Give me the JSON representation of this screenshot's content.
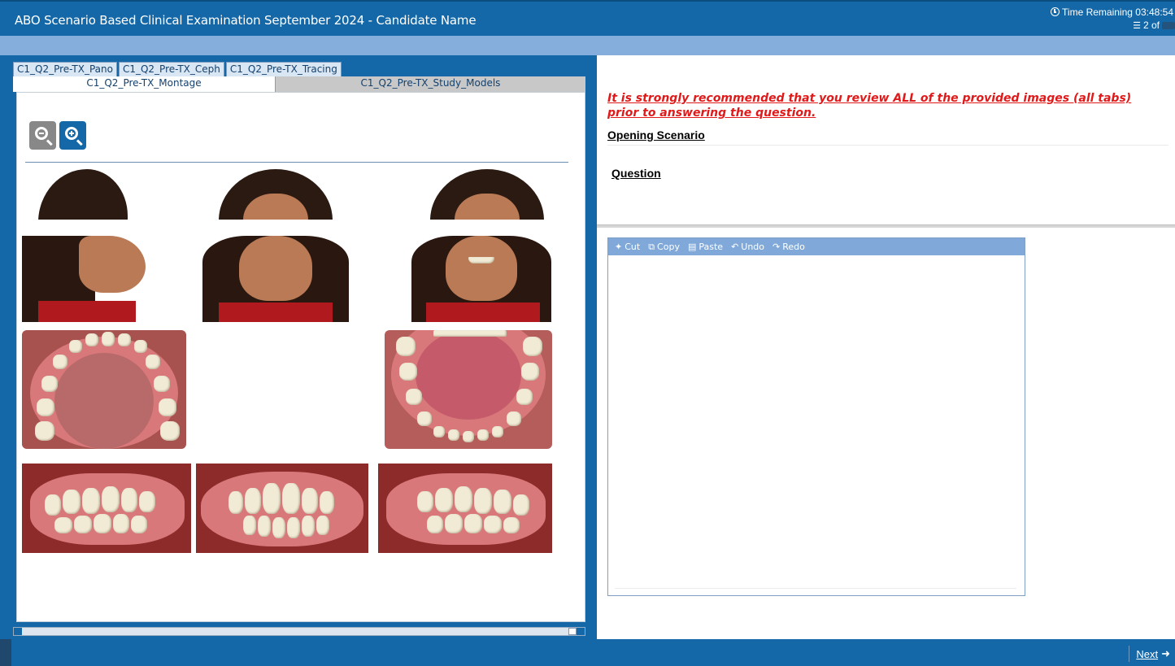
{
  "header": {
    "title": "ABO Scenario Based Clinical Examination September 2024 - Candidate Name",
    "timer_label": "Time Remaining 03:48:54",
    "progress_label": "2 of"
  },
  "tabs": {
    "row1": [
      "C1_Q2_Pre-TX_Pano",
      "C1_Q2_Pre-TX_Ceph",
      "C1_Q2_Pre-TX_Tracing"
    ],
    "row2": [
      "C1_Q2_Pre-TX_Montage",
      "C1_Q2_Pre-TX_Study_Models"
    ],
    "active": "C1_Q2_Pre-TX_Montage"
  },
  "viewer": {
    "zoom_out_icon": "zoom-out-icon",
    "zoom_in_icon": "zoom-in-icon"
  },
  "question": {
    "warning": "It is strongly recommended that you review ALL of the provided images (all tabs) prior to answering the question.",
    "opening_label": "Opening Scenario",
    "question_label": "Question"
  },
  "editor": {
    "toolbar": [
      {
        "icon": "cut-icon",
        "label": "Cut"
      },
      {
        "icon": "copy-icon",
        "label": "Copy"
      },
      {
        "icon": "paste-icon",
        "label": "Paste"
      },
      {
        "icon": "undo-icon",
        "label": "Undo"
      },
      {
        "icon": "redo-icon",
        "label": "Redo"
      }
    ]
  },
  "footer": {
    "next_label": "Next"
  },
  "colors": {
    "primary_blue": "#1468a8",
    "light_blue": "#86aedc",
    "warning_red": "#e01a1a"
  }
}
